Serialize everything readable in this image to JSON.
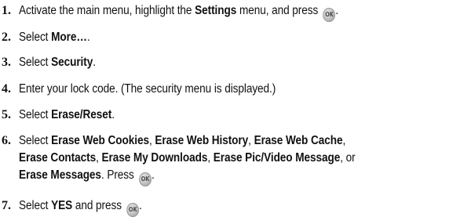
{
  "steps": [
    {
      "number": "1.",
      "parts": [
        {
          "t": "Activate the main menu, highlight the "
        },
        {
          "t": "Settings",
          "b": true
        },
        {
          "t": " menu, and press "
        },
        {
          "icon": "ok-button-icon"
        },
        {
          "t": "."
        }
      ]
    },
    {
      "number": "2.",
      "parts": [
        {
          "t": "Select "
        },
        {
          "t": "More…",
          "b": true
        },
        {
          "t": "."
        }
      ]
    },
    {
      "number": "3.",
      "parts": [
        {
          "t": "Select "
        },
        {
          "t": "Security",
          "b": true
        },
        {
          "t": "."
        }
      ]
    },
    {
      "number": "4.",
      "parts": [
        {
          "t": "Enter your lock code. (The security menu is displayed.)"
        }
      ]
    },
    {
      "number": "5.",
      "parts": [
        {
          "t": "Select "
        },
        {
          "t": "Erase/Reset",
          "b": true
        },
        {
          "t": "."
        }
      ]
    },
    {
      "number": "6.",
      "lines": [
        [
          {
            "t": "Select "
          },
          {
            "t": "Erase Web Cookies",
            "b": true
          },
          {
            "t": ", "
          },
          {
            "t": "Erase Web History",
            "b": true
          },
          {
            "t": ", "
          },
          {
            "t": "Erase Web Cache",
            "b": true
          },
          {
            "t": ","
          }
        ],
        [
          {
            "t": "Erase Contacts",
            "b": true
          },
          {
            "t": ", "
          },
          {
            "t": "Erase My Downloads",
            "b": true
          },
          {
            "t": ", "
          },
          {
            "t": "Erase Pic/Video Message",
            "b": true
          },
          {
            "t": ", or"
          }
        ],
        [
          {
            "t": "Erase Messages",
            "b": true
          },
          {
            "t": ". Press "
          },
          {
            "icon": "ok-button-icon"
          },
          {
            "t": "."
          }
        ]
      ]
    },
    {
      "number": "7.",
      "parts": [
        {
          "t": "Select "
        },
        {
          "t": "YES",
          "b": true
        },
        {
          "t": " and press "
        },
        {
          "icon": "ok-button-icon"
        },
        {
          "t": "."
        }
      ]
    }
  ],
  "ok_icon_label": "OK"
}
